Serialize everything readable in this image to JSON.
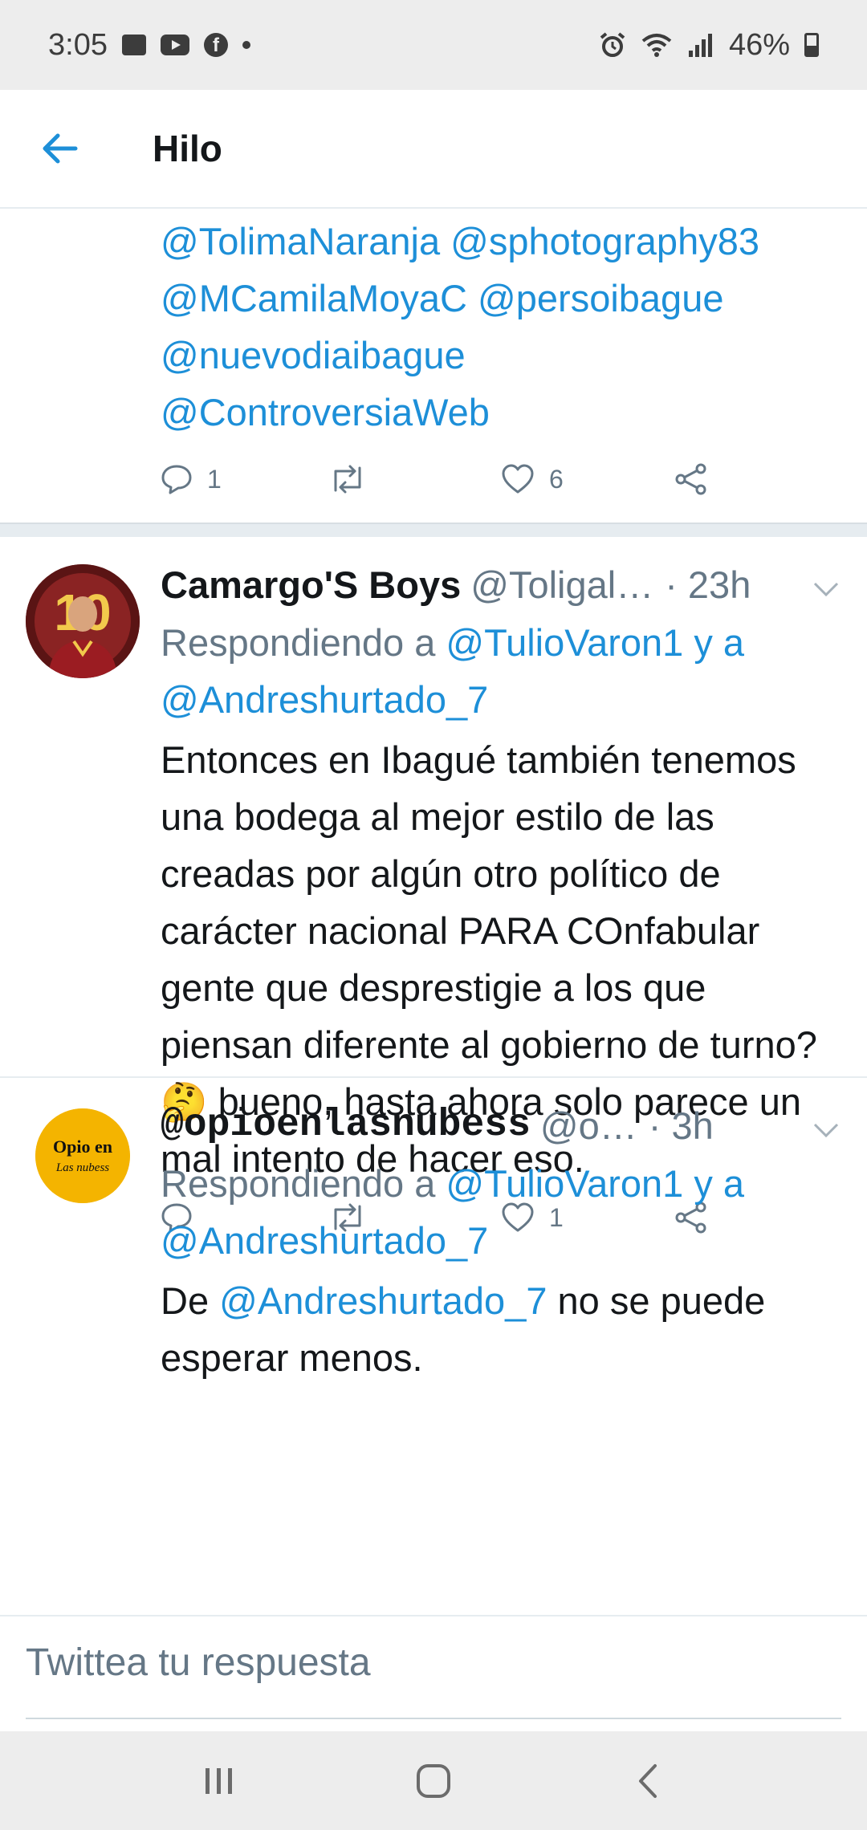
{
  "status_bar": {
    "time": "3:05",
    "battery": "46%",
    "left_icons": [
      "gallery-icon",
      "youtube-icon",
      "facebook-icon",
      "dot-icon"
    ],
    "right_icons": [
      "alarm-icon",
      "wifi-icon",
      "signal-icon",
      "battery-icon"
    ]
  },
  "header": {
    "title": "Hilo",
    "back_icon": "arrow-left-icon"
  },
  "colors": {
    "accent": "#1d8fd8",
    "secondary_text": "#657786",
    "divider": "#e6ecf0"
  },
  "partial_tweet": {
    "mention_lines": [
      "@TolimaNaranja @sphotography83",
      "@MCamilaMoyaC @persoibague",
      "@nuevodiaibague",
      "@ControversiaWeb"
    ],
    "reply_count": "1",
    "like_count": "6"
  },
  "tweets": [
    {
      "name": "Camargo'S Boys",
      "handle": "@Toligal…",
      "time": "· 23h",
      "replying_prefix": "Respondiendo a",
      "replying_to_1": "@TulioVaron1 y a",
      "replying_to_2": "@Andreshurtado_7",
      "text": "Entonces en Ibagué también tenemos una bodega al mejor estilo de las creadas por algún otro político de carácter nacional PARA COnfabular gente que desprestigie a los que piensan diferente al gobierno de turno? 🤔 bueno, hasta ahora solo parece un mal intento de hacer eso.",
      "reply_count": "",
      "like_count": "1",
      "avatar_text": "10"
    },
    {
      "name": "@opioenlasnubess",
      "handle": "@o…",
      "time": "· 3h",
      "replying_prefix": "Respondiendo a",
      "replying_to_1": "@TulioVaron1 y a",
      "replying_to_2": "@Andreshurtado_7",
      "text_before": "De",
      "text_mention": "@Andreshurtado_7",
      "text_after": "no se puede esperar menos.",
      "avatar_line1": "Opio en",
      "avatar_line2": "Las nubess"
    }
  ],
  "reply_bar": {
    "placeholder": "Twittea tu respuesta"
  },
  "nav_bar": {
    "icons": [
      "recent-apps-icon",
      "home-icon",
      "back-icon"
    ]
  }
}
